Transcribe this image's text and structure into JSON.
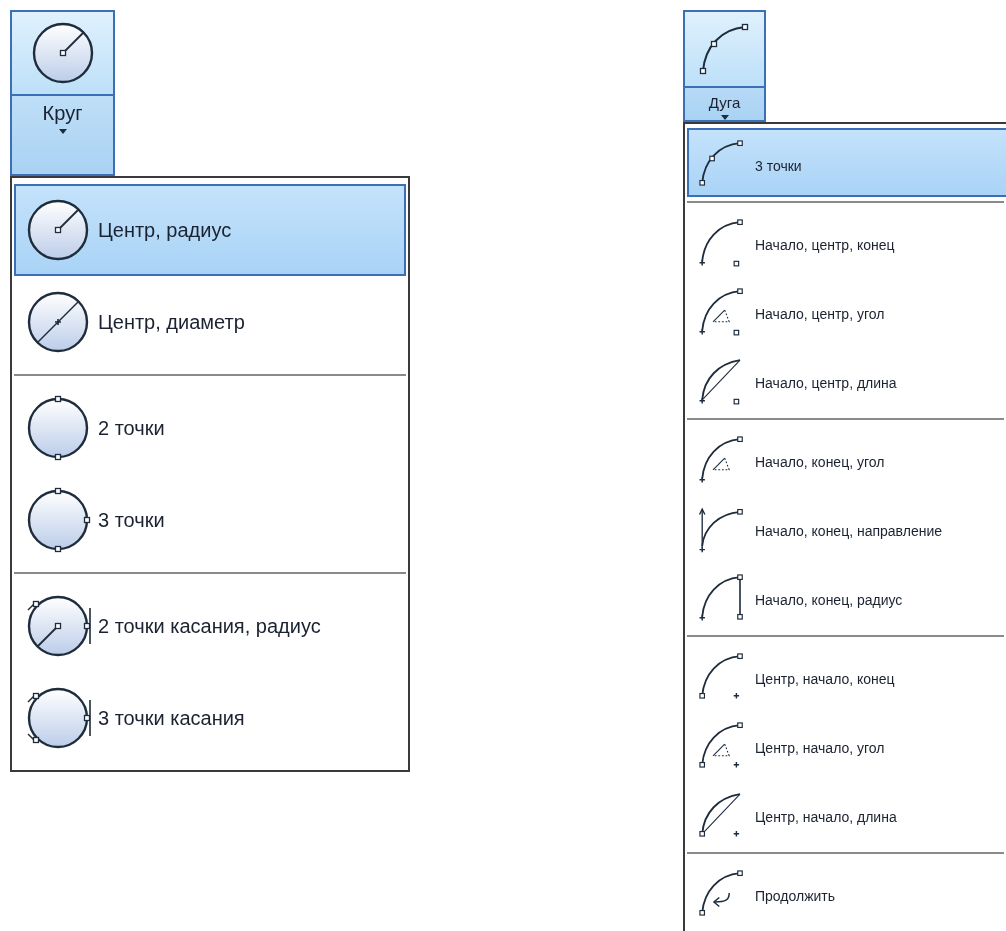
{
  "menus": [
    {
      "button": {
        "label": "Круг"
      },
      "groups": [
        {
          "items": [
            {
              "label": "Центр, радиус",
              "selected": true
            },
            {
              "label": "Центр, диаметр",
              "selected": false
            }
          ]
        },
        {
          "items": [
            {
              "label": "2 точки",
              "selected": false
            },
            {
              "label": "3 точки",
              "selected": false
            }
          ]
        },
        {
          "items": [
            {
              "label": "2 точки касания, радиус",
              "selected": false
            },
            {
              "label": "3 точки касания",
              "selected": false
            }
          ]
        }
      ]
    },
    {
      "button": {
        "label": "Дуга"
      },
      "groups": [
        {
          "items": [
            {
              "label": "3 точки",
              "selected": true
            }
          ]
        },
        {
          "items": [
            {
              "label": "Начало, центр, конец",
              "selected": false
            },
            {
              "label": "Начало, центр, угол",
              "selected": false
            },
            {
              "label": "Начало, центр, длина",
              "selected": false
            }
          ]
        },
        {
          "items": [
            {
              "label": "Начало, конец, угол",
              "selected": false
            },
            {
              "label": "Начало, конец, направление",
              "selected": false
            },
            {
              "label": "Начало, конец, радиус",
              "selected": false
            }
          ]
        },
        {
          "items": [
            {
              "label": "Центр, начало, конец",
              "selected": false
            },
            {
              "label": "Центр, начало, угол",
              "selected": false
            },
            {
              "label": "Центр, начало, длина",
              "selected": false
            }
          ]
        },
        {
          "items": [
            {
              "label": "Продолжить",
              "selected": false
            }
          ]
        }
      ]
    }
  ]
}
